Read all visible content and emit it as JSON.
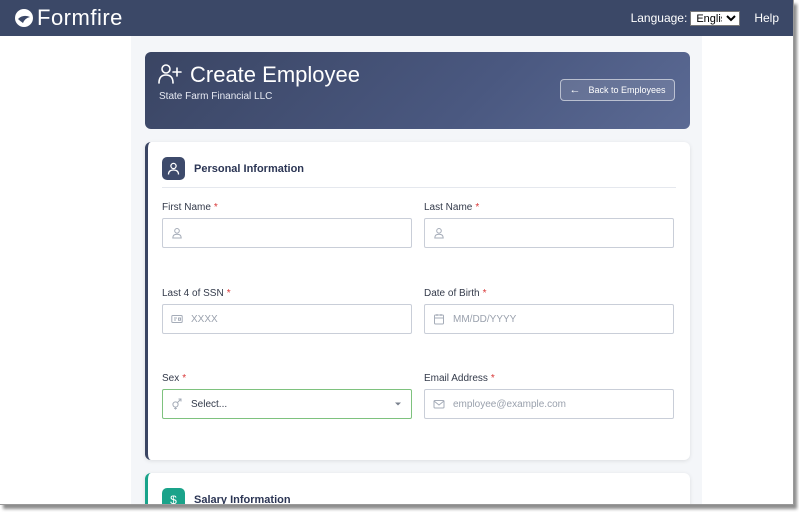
{
  "nav": {
    "brand": "Formfire",
    "language_label": "Language:",
    "language_value": "English",
    "help": "Help"
  },
  "header": {
    "title": "Create Employee",
    "subtitle": "State Farm Financial LLC",
    "back_button": "Back to Employees"
  },
  "sections": {
    "personal": {
      "title": "Personal Information",
      "fields": {
        "first_name": {
          "label": "First Name",
          "required": "*",
          "placeholder": ""
        },
        "last_name": {
          "label": "Last Name",
          "required": "*",
          "placeholder": ""
        },
        "ssn": {
          "label": "Last 4 of SSN",
          "required": "*",
          "placeholder": "XXXX"
        },
        "dob": {
          "label": "Date of Birth",
          "required": "*",
          "placeholder": "MM/DD/YYYY"
        },
        "sex": {
          "label": "Sex",
          "required": "*",
          "value": "Select..."
        },
        "email": {
          "label": "Email Address",
          "required": "*",
          "placeholder": "employee@example.com"
        }
      }
    },
    "salary": {
      "title": "Salary Information",
      "icon_glyph": "$"
    }
  },
  "colors": {
    "navbar": "#3b4867",
    "hero": "#3a4563",
    "required": "#d93636",
    "salary_accent": "#1aa38a",
    "active_border": "#7ec27e"
  },
  "icons": {
    "logo": "formfire-logo-icon",
    "header": "add-user-icon",
    "back": "arrow-left-icon",
    "personal": "user-icon",
    "name_fields": "user-icon",
    "ssn": "id-card-icon",
    "dob": "calendar-icon",
    "sex": "gender-icon",
    "email": "mail-icon",
    "dropdown": "chevron-down-icon"
  }
}
